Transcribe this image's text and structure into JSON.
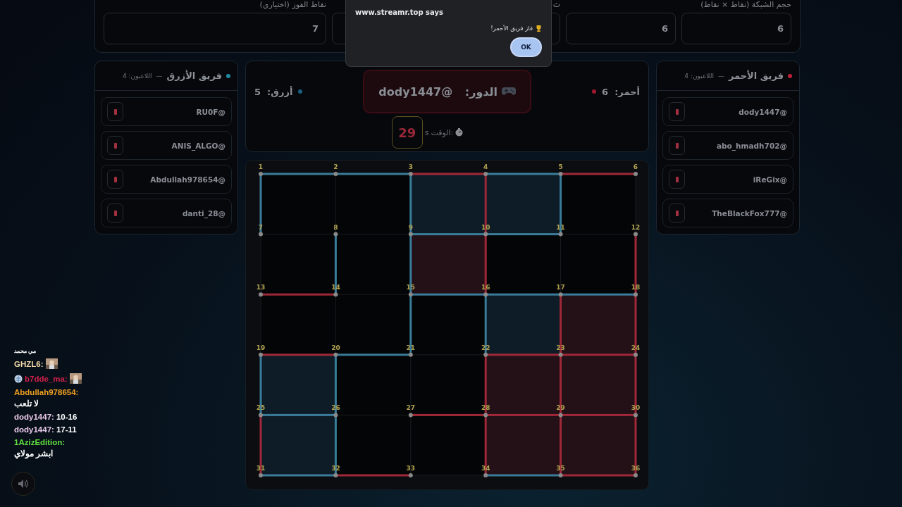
{
  "settings": {
    "fields": [
      {
        "label": "حجم الشبكة (نقاط × نقاط)",
        "value": "6"
      },
      {
        "value": "6"
      },
      {
        "label": "ث"
      },
      {
        "label": "نقاط الفوز (اختياري)",
        "value": "7"
      }
    ]
  },
  "dialog": {
    "title": "www.streamr.top says",
    "message": "فاز فريق الأحمر!",
    "button": "OK"
  },
  "blue_team": {
    "name": "فريق الأزرق",
    "separator": "—",
    "count": "اللاعبون: 4",
    "color": "#1e8aa0",
    "players": [
      "@RU0F",
      "@ANIS_ALGO",
      "@Abdullah978654",
      "@danti_28"
    ]
  },
  "red_team": {
    "name": "فريق الأحمر",
    "separator": "—",
    "count": "اللاعبون: 4",
    "color": "#c0203a",
    "players": [
      "@dody1447",
      "@abo_hmadh702",
      "@iReGix",
      "@TheBlackFox777"
    ]
  },
  "status": {
    "turn_label": "الدور:",
    "turn_player": "@dody1447",
    "red_score": "أحمر:  6",
    "blue_score": "أزرق:  5",
    "timer_label": "الوقت:",
    "timer_unit": "s",
    "timer_value": "29"
  },
  "board": {
    "points": [
      [
        "6",
        "5",
        "4",
        "3",
        "2",
        "1"
      ],
      [
        "12",
        "11",
        "10",
        "9",
        "8",
        "7"
      ],
      [
        "18",
        "17",
        "16",
        "15",
        "14",
        "13"
      ],
      [
        "24",
        "23",
        "22",
        "21",
        "20",
        "19"
      ],
      [
        "30",
        "29",
        "28",
        "27",
        "26",
        "25"
      ],
      [
        "36",
        "35",
        "34",
        "33",
        "32",
        "31"
      ]
    ],
    "h_edges": [
      [
        {
          "claimed": true,
          "color": "#3a7d9a"
        },
        {
          "claimed": true,
          "color": "#3a7d9a"
        },
        {
          "claimed": true,
          "color": "#a02838"
        },
        {
          "claimed": true,
          "color": "#3a7d9a"
        },
        {
          "claimed": true,
          "color": "#a02838"
        }
      ],
      [
        {
          "claimed": false
        },
        {
          "claimed": false
        },
        {
          "claimed": true,
          "color": "#3a7d9a"
        },
        {
          "claimed": true,
          "color": "#3a7d9a"
        },
        {
          "claimed": false
        }
      ],
      [
        {
          "claimed": true,
          "color": "#a02838"
        },
        {
          "claimed": false
        },
        {
          "claimed": true,
          "color": "#3a7d9a"
        },
        {
          "claimed": true,
          "color": "#3a7d9a"
        },
        {
          "claimed": true,
          "color": "#3a7d9a"
        }
      ],
      [
        {
          "claimed": true,
          "color": "#a02838"
        },
        {
          "claimed": true,
          "color": "#3a7d9a"
        },
        {
          "claimed": false
        },
        {
          "claimed": true,
          "color": "#a02838"
        },
        {
          "claimed": true,
          "color": "#a02838"
        }
      ],
      [
        {
          "claimed": true,
          "color": "#3a7d9a"
        },
        {
          "claimed": false
        },
        {
          "claimed": true,
          "color": "#a02838"
        },
        {
          "claimed": true,
          "color": "#a02838"
        },
        {
          "claimed": true,
          "color": "#a02838"
        }
      ],
      [
        {
          "claimed": true,
          "color": "#3a7d9a"
        },
        {
          "claimed": true,
          "color": "#a02838"
        },
        {
          "claimed": false
        },
        {
          "claimed": true,
          "color": "#3a7d9a"
        },
        {
          "claimed": true,
          "color": "#a02838"
        }
      ]
    ],
    "v_edges": [
      [
        {
          "claimed": true,
          "color": "#3a7d9a"
        },
        {
          "claimed": false
        },
        {
          "claimed": true,
          "color": "#3a7d9a"
        },
        {
          "claimed": true,
          "color": "#a02838"
        },
        {
          "claimed": true,
          "color": "#3a7d9a"
        },
        {
          "claimed": false
        }
      ],
      [
        {
          "claimed": false
        },
        {
          "claimed": true,
          "color": "#3a7d9a"
        },
        {
          "claimed": true,
          "color": "#3a7d9a"
        },
        {
          "claimed": true,
          "color": "#a02838"
        },
        {
          "claimed": false
        },
        {
          "claimed": true,
          "color": "#a02838"
        }
      ],
      [
        {
          "claimed": false
        },
        {
          "claimed": false
        },
        {
          "claimed": true,
          "color": "#3a7d9a"
        },
        {
          "claimed": true,
          "color": "#3a7d9a"
        },
        {
          "claimed": true,
          "color": "#a02838"
        },
        {
          "claimed": true,
          "color": "#a02838"
        }
      ],
      [
        {
          "claimed": true,
          "color": "#3a7d9a"
        },
        {
          "claimed": true,
          "color": "#3a7d9a"
        },
        {
          "claimed": false
        },
        {
          "claimed": true,
          "color": "#a02838"
        },
        {
          "claimed": true,
          "color": "#a02838"
        },
        {
          "claimed": true,
          "color": "#a02838"
        }
      ],
      [
        {
          "claimed": true,
          "color": "#a02838"
        },
        {
          "claimed": true,
          "color": "#3a7d9a"
        },
        {
          "claimed": false
        },
        {
          "claimed": true,
          "color": "#a02838"
        },
        {
          "claimed": true,
          "color": "#a02838"
        },
        {
          "claimed": true,
          "color": "#a02838"
        }
      ]
    ],
    "boxes": [
      [
        {
          "color": "#040506"
        },
        {
          "color": "#040506"
        },
        {
          "color": "#0e1c27"
        },
        {
          "color": "#0e1c27"
        },
        {
          "color": "#040506"
        }
      ],
      [
        {
          "color": "#040506"
        },
        {
          "color": "#040506"
        },
        {
          "color": "#241017"
        },
        {
          "color": "#040506"
        },
        {
          "color": "#040506"
        }
      ],
      [
        {
          "color": "#040506"
        },
        {
          "color": "#040506"
        },
        {
          "color": "#040506"
        },
        {
          "color": "#0e1c27"
        },
        {
          "color": "#241017"
        }
      ],
      [
        {
          "color": "#0e1c27"
        },
        {
          "color": "#040506"
        },
        {
          "color": "#040506"
        },
        {
          "color": "#241017"
        },
        {
          "color": "#241017"
        }
      ],
      [
        {
          "color": "#0e1c27"
        },
        {
          "color": "#040506"
        },
        {
          "color": "#040506"
        },
        {
          "color": "#241017"
        },
        {
          "color": "#241017"
        }
      ]
    ]
  },
  "chat": [
    {
      "kind": "note",
      "text": "مي محمد"
    },
    {
      "kind": "picture",
      "user": "GHZL6:",
      "color": "#f0d8a8",
      "badge": false
    },
    {
      "kind": "picture",
      "user": "b7dde_ma:",
      "color": "#d0204a",
      "badge": true
    },
    {
      "kind": "text",
      "user": "Abdullah978654:",
      "color": "#f0a020",
      "badge": false,
      "text": "لا تلعب"
    },
    {
      "kind": "text",
      "user": "dody1447:",
      "color": "#e8c8e8",
      "badge": false,
      "text": "10-16"
    },
    {
      "kind": "text",
      "user": "dody1447:",
      "color": "#e8c8e8",
      "badge": false,
      "text": "17-11"
    },
    {
      "kind": "text",
      "user": "1AzizEdition:",
      "color": "#60e040",
      "badge": false,
      "text": "ابشر مولاي"
    }
  ]
}
